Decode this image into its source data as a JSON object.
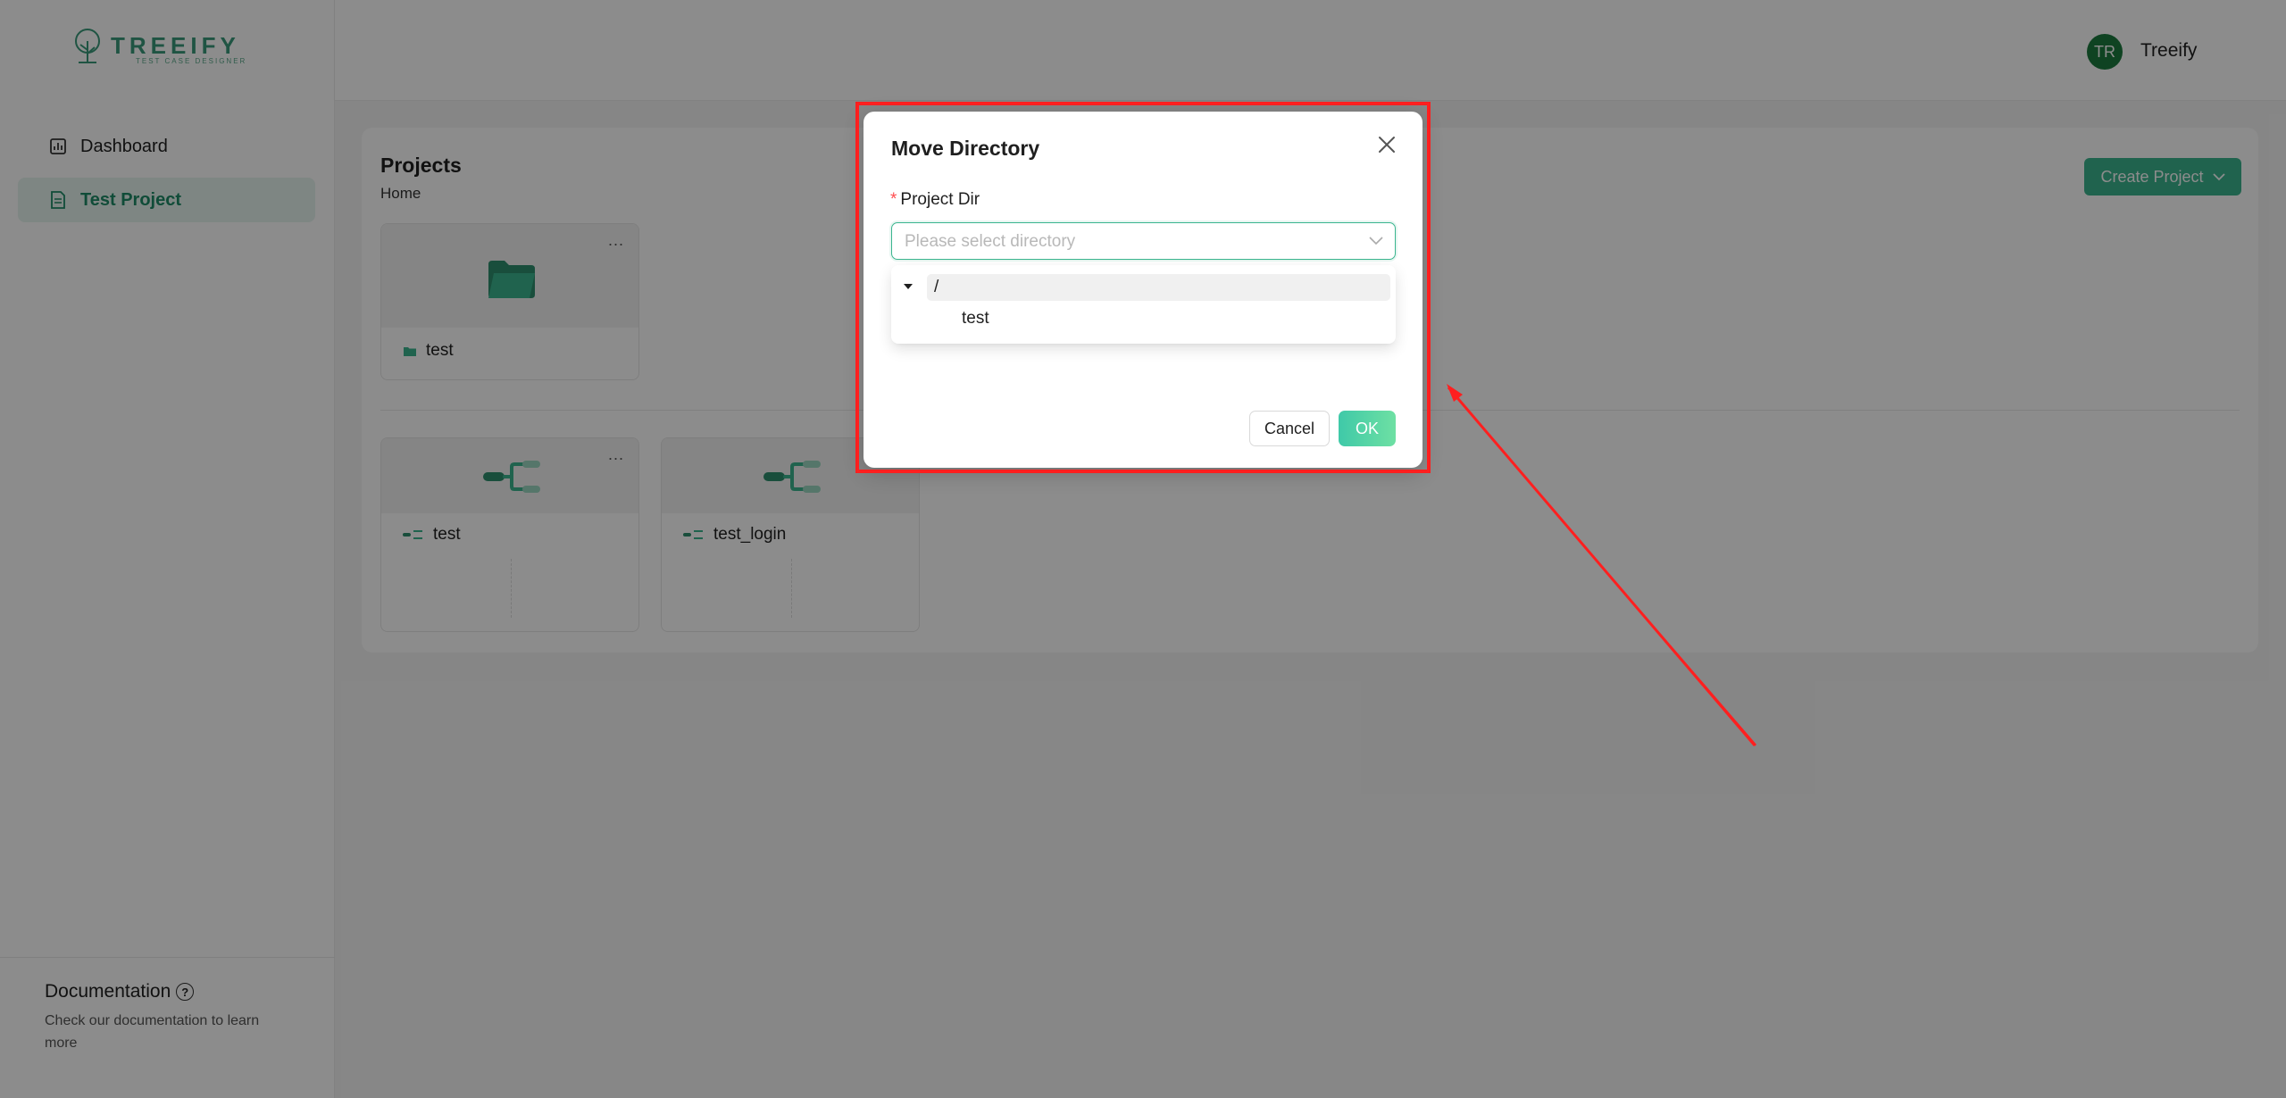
{
  "app": {
    "logo_text": "TREEIFY",
    "logo_subtitle": "TEST CASE DESIGNER",
    "brand_color": "#3bb58f"
  },
  "sidebar": {
    "items": [
      {
        "label": "Dashboard",
        "icon": "dashboard-icon",
        "active": false
      },
      {
        "label": "Test Project",
        "icon": "document-icon",
        "active": true
      }
    ],
    "docs_title": "Documentation",
    "docs_desc": "Check our documentation to learn more"
  },
  "header": {
    "avatar_initials": "TR",
    "user_name": "Treeify"
  },
  "main": {
    "title": "Projects",
    "breadcrumb": "Home",
    "create_button": "Create Project",
    "folders": [
      {
        "name": "test"
      }
    ],
    "cases": [
      {
        "name": "test"
      },
      {
        "name": "test_login"
      }
    ],
    "more_label": "..."
  },
  "modal": {
    "title": "Move Directory",
    "field_label": "Project Dir",
    "required_mark": "*",
    "select_placeholder": "Please select directory",
    "tree": {
      "root": "/",
      "children": [
        "test"
      ]
    },
    "cancel_label": "Cancel",
    "ok_label": "OK"
  },
  "annotation": {
    "color": "#ff1f1f"
  }
}
